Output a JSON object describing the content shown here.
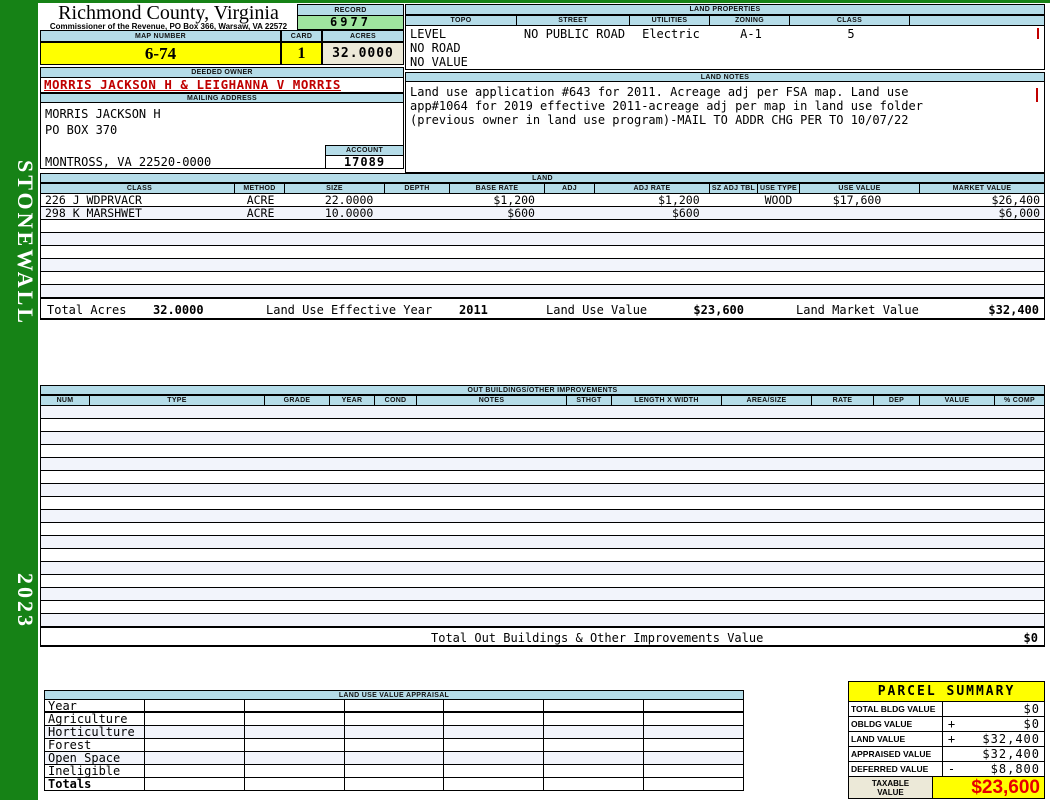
{
  "sidebar": {
    "district": "STONEWALL",
    "year": "2023"
  },
  "header": {
    "county": "Richmond County, Virginia",
    "subtitle": "Commissioner of the Revenue, PO Box 366, Warsaw, VA 22572",
    "record_label": "RECORD",
    "record": "6977",
    "map_number_label": "MAP NUMBER",
    "map_number": "6-74",
    "card_label": "CARD",
    "card": "1",
    "acres_label": "ACRES",
    "acres": "32.0000"
  },
  "owner": {
    "deeded_owner_label": "DEEDED OWNER",
    "deeded_owner": "MORRIS JACKSON H & LEIGHANNA V MORRIS",
    "mailing_address_label": "MAILING ADDRESS",
    "mailing_lines": [
      "MORRIS JACKSON H",
      "PO BOX 370",
      "",
      "MONTROSS, VA 22520-0000"
    ],
    "account_label": "ACCOUNT",
    "account": "17089"
  },
  "land_properties": {
    "title": "LAND PROPERTIES",
    "columns": [
      "TOPO",
      "STREET",
      "UTILITIES",
      "ZONING",
      "CLASS"
    ],
    "topo_lines": [
      "LEVEL",
      "NO ROAD",
      "NO VALUE"
    ],
    "street": "NO PUBLIC ROAD",
    "utilities": "Electric",
    "zoning": "A-1",
    "class": "5"
  },
  "land_notes": {
    "title": "LAND NOTES",
    "lines": [
      "Land use application #643 for 2011. Acreage adj per FSA map. Land use",
      "app#1064 for 2019 effective 2011-acreage adj per map in land use folder",
      "(previous owner in land use program)-MAIL TO ADDR CHG PER TO 10/07/22"
    ]
  },
  "land": {
    "title": "LAND",
    "columns": [
      "CLASS",
      "METHOD",
      "SIZE",
      "DEPTH",
      "BASE RATE",
      "ADJ",
      "ADJ RATE",
      "SZ ADJ TBL",
      "USE TYPE",
      "USE VALUE",
      "MARKET VALUE"
    ],
    "rows": [
      {
        "class": "226 J WDPRVACR",
        "method": "ACRE",
        "size": "22.0000",
        "depth": "",
        "base_rate": "$1,200",
        "adj": "",
        "adj_rate": "$1,200",
        "sz_adj_tbl": "",
        "use_type": "WOOD",
        "use_value": "$17,600",
        "market_value": "$26,400"
      },
      {
        "class": "298 K MARSHWET",
        "method": "ACRE",
        "size": "10.0000",
        "depth": "",
        "base_rate": "$600",
        "adj": "",
        "adj_rate": "$600",
        "sz_adj_tbl": "",
        "use_type": "",
        "use_value": "",
        "market_value": "$6,000"
      }
    ],
    "totals": {
      "total_acres_label": "Total Acres",
      "total_acres": "32.0000",
      "effective_year_label": "Land Use Effective Year",
      "effective_year": "2011",
      "use_value_label": "Land Use Value",
      "use_value": "$23,600",
      "market_value_label": "Land Market Value",
      "market_value": "$32,400"
    }
  },
  "out_buildings": {
    "title": "OUT BUILDINGS/OTHER IMPROVEMENTS",
    "columns": [
      "NUM",
      "TYPE",
      "GRADE",
      "YEAR",
      "COND",
      "NOTES",
      "STHGT",
      "LENGTH X WIDTH",
      "AREA/SIZE",
      "RATE",
      "DEP",
      "VALUE",
      "% COMP"
    ],
    "total_label": "Total Out Buildings & Other Improvements Value",
    "total_value": "$0"
  },
  "land_use_appraisal": {
    "title": "LAND USE VALUE APPRAISAL",
    "row_labels": [
      "Year",
      "Agriculture",
      "Horticulture",
      "Forest",
      "Open Space",
      "Ineligible",
      "Totals"
    ]
  },
  "parcel_summary": {
    "title": "PARCEL SUMMARY",
    "rows": [
      {
        "label": "TOTAL BLDG VALUE",
        "op": "",
        "value": "$0"
      },
      {
        "label": "OBLDG VALUE",
        "op": "+",
        "value": "$0"
      },
      {
        "label": "LAND VALUE",
        "op": "+",
        "value": "$32,400"
      },
      {
        "label": "APPRAISED VALUE",
        "op": "",
        "value": "$32,400"
      },
      {
        "label": "DEFERRED VALUE",
        "op": "-",
        "value": "$8,800"
      }
    ],
    "taxable_label_line1": "TAXABLE",
    "taxable_label_line2": "VALUE",
    "taxable_value": "$23,600"
  },
  "colors": {
    "sidebar_green": "#168216",
    "header_blue": "#b5dce8",
    "record_green": "#9fe49f",
    "highlight_yellow": "#ffff00",
    "beige": "#ece9d8",
    "owner_red": "#c00000",
    "taxable_red": "#e60000"
  }
}
